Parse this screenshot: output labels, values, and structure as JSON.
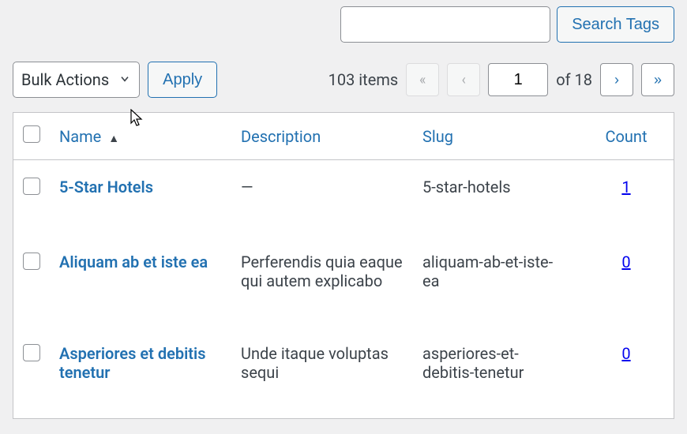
{
  "search": {
    "placeholder": "",
    "button": "Search Tags"
  },
  "bulk": {
    "label": "Bulk Actions",
    "apply": "Apply"
  },
  "pagination": {
    "items_text": "103 items",
    "first": "«",
    "prev": "‹",
    "current": "1",
    "of_text": "of 18",
    "next": "›",
    "last": "»"
  },
  "columns": {
    "name": "Name",
    "description": "Description",
    "slug": "Slug",
    "count": "Count"
  },
  "rows": [
    {
      "name": "5-Star Hotels",
      "description": "—",
      "slug": "5-star-hotels",
      "count": "1"
    },
    {
      "name": "Aliquam ab et iste ea",
      "description": "Perferendis quia eaque qui autem explicabo",
      "slug": "aliquam-ab-et-iste-ea",
      "count": "0"
    },
    {
      "name": "Asperiores et debitis tenetur",
      "description": "Unde itaque voluptas sequi",
      "slug": "asperiores-et-debitis-tenetur",
      "count": "0"
    }
  ]
}
